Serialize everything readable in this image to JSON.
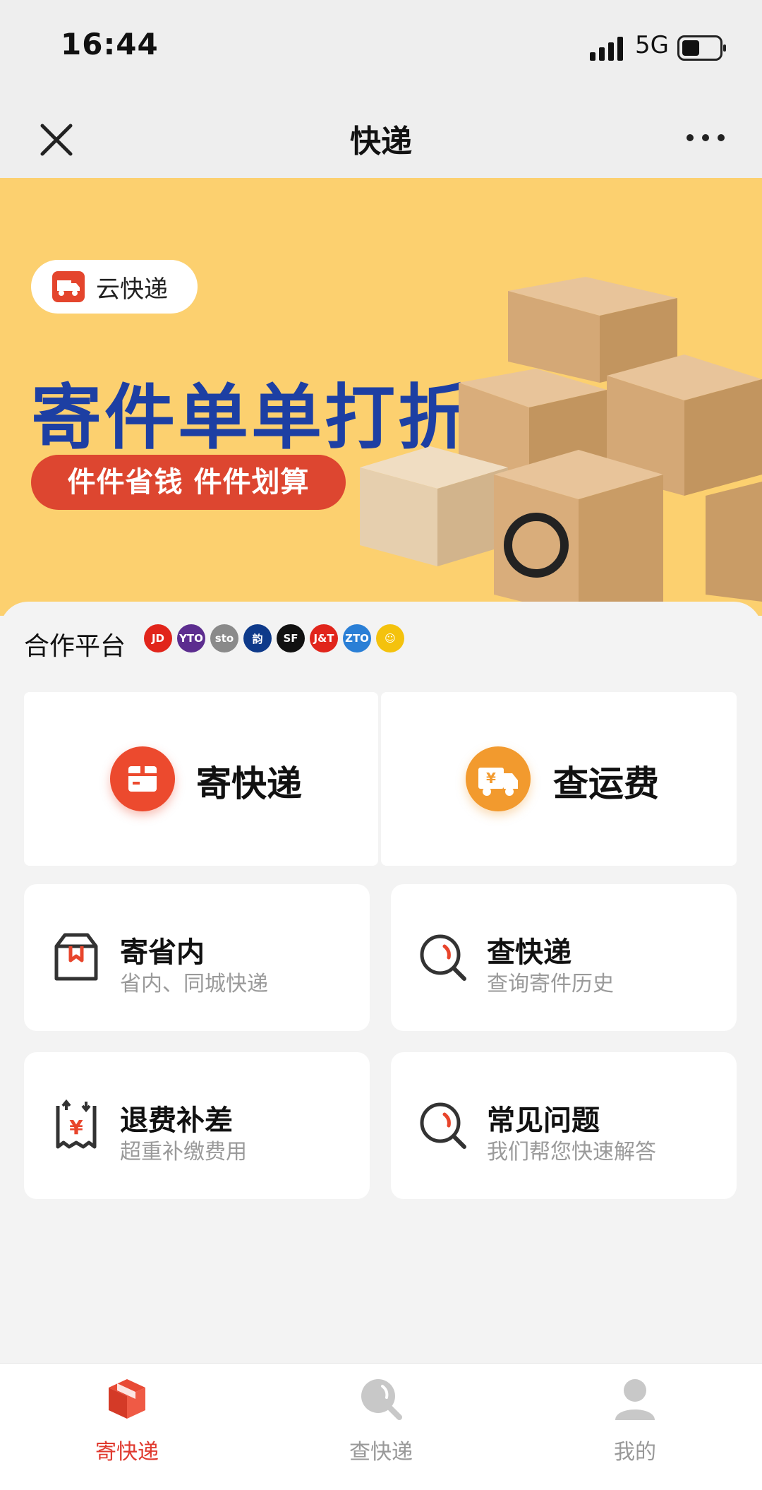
{
  "status_bar": {
    "time": "16:44",
    "network": "5G"
  },
  "nav": {
    "title": "快递"
  },
  "banner": {
    "brand": "云快递",
    "headline": "寄件单单打折",
    "subline": "件件省钱 件件划算"
  },
  "partners": {
    "label": "合作平台",
    "logos": [
      {
        "name": "jd-logo-icon",
        "text": "JD",
        "color": "#e1251b"
      },
      {
        "name": "yto-logo-icon",
        "text": "YTO",
        "color": "#5c2d8f"
      },
      {
        "name": "sto-logo-icon",
        "text": "sto",
        "color": "#8a8a8a"
      },
      {
        "name": "yunda-logo-icon",
        "text": "韵",
        "color": "#0e3a8a"
      },
      {
        "name": "sf-logo-icon",
        "text": "SF",
        "color": "#111111"
      },
      {
        "name": "jt-logo-icon",
        "text": "J&T",
        "color": "#e1251b"
      },
      {
        "name": "zto-logo-icon",
        "text": "ZTO",
        "color": "#2a7fd6"
      },
      {
        "name": "smile-logo-icon",
        "text": "☺",
        "color": "#f4c20d"
      }
    ]
  },
  "main_actions": {
    "send": "寄快递",
    "fee": "查运费"
  },
  "services": [
    {
      "title": "寄省内",
      "subtitle": "省内、同城快递",
      "icon": "box-icon"
    },
    {
      "title": "查快递",
      "subtitle": "查询寄件历史",
      "icon": "search-icon"
    },
    {
      "title": "退费补差",
      "subtitle": "超重补缴费用",
      "icon": "receipt-icon"
    },
    {
      "title": "常见问题",
      "subtitle": "我们帮您快速解答",
      "icon": "search-icon"
    }
  ],
  "tabs": [
    {
      "label": "寄快递",
      "active": true,
      "icon": "package-icon"
    },
    {
      "label": "查快递",
      "active": false,
      "icon": "search-icon"
    },
    {
      "label": "我的",
      "active": false,
      "icon": "user-icon"
    }
  ],
  "colors": {
    "accent": "#e03a2f",
    "banner_bg": "#fcd06f",
    "headline": "#1d3fa3",
    "orange": "#f29a2e"
  }
}
